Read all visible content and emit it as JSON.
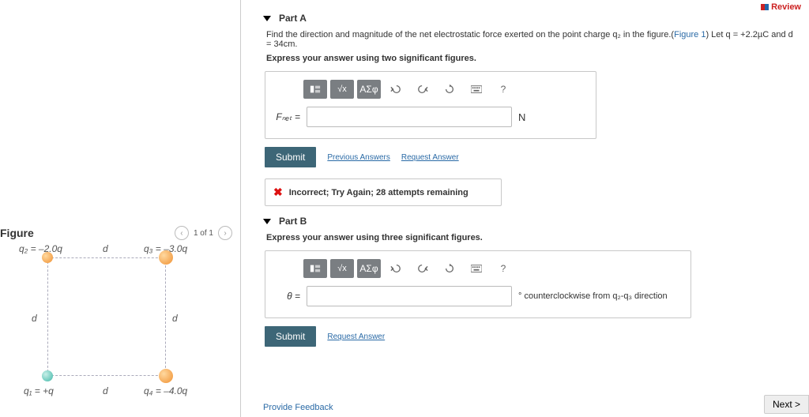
{
  "header": {
    "review": "Review"
  },
  "partA": {
    "title": "Part A",
    "question_pre": "Find the direction and magnitude of the net electrostatic force exerted on the point charge q₂ in the figure.(",
    "figure_link": "Figure 1",
    "question_post": ") Let q = +2.2µC and d = 34cm.",
    "instr": "Express your answer using two significant figures.",
    "var_label": "Fₙₑₜ =",
    "unit": "N",
    "submit": "Submit",
    "prev_ans": "Previous Answers",
    "req_ans": "Request Answer",
    "feedback": "Incorrect; Try Again; 28 attempts remaining"
  },
  "partB": {
    "title": "Part B",
    "instr": "Express your answer using three significant figures.",
    "var_label": "θ =",
    "unit_deg": "°",
    "unit_text": "counterclockwise from q₂-q₃ direction",
    "submit": "Submit",
    "req_ans": "Request Answer"
  },
  "toolbar": {
    "greek": "ΑΣφ",
    "help": "?"
  },
  "figure": {
    "head": "Figure",
    "nav": "1 of 1",
    "q2": "q₂ = –2.0q",
    "q3": "q₃ = –3.0q",
    "q1": "q₁ = +q",
    "q4": "q₄ = –4.0q",
    "d": "d"
  },
  "footer": {
    "feedback": "Provide Feedback",
    "next": "Next >"
  }
}
